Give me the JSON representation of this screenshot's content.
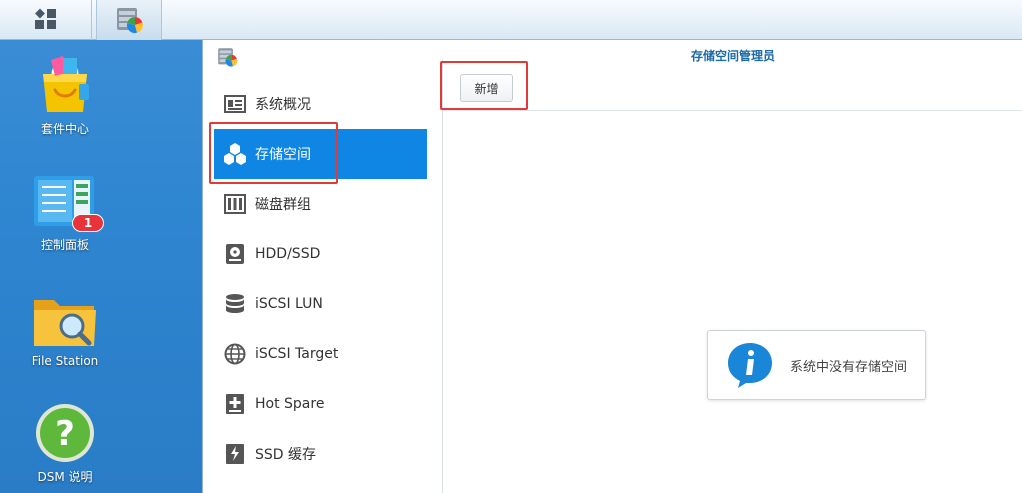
{
  "desktop": {
    "icons": [
      {
        "label": "套件中心"
      },
      {
        "label": "控制面板",
        "badge": "1"
      },
      {
        "label": "File Station"
      },
      {
        "label": "DSM 说明"
      }
    ]
  },
  "window": {
    "title": "存储空间管理员",
    "sidebar": {
      "items": [
        {
          "label": "系统概况",
          "icon": "overview-icon"
        },
        {
          "label": "存储空间",
          "icon": "storage-cubes-icon",
          "active": true
        },
        {
          "label": "磁盘群组",
          "icon": "disk-group-icon"
        },
        {
          "label": "HDD/SSD",
          "icon": "hdd-icon"
        },
        {
          "label": "iSCSI LUN",
          "icon": "database-icon"
        },
        {
          "label": "iSCSI Target",
          "icon": "globe-icon"
        },
        {
          "label": "Hot Spare",
          "icon": "hot-spare-icon"
        },
        {
          "label": "SSD 缓存",
          "icon": "ssd-cache-icon"
        }
      ]
    },
    "toolbar": {
      "add_label": "新增"
    },
    "empty_message": "系统中没有存储空间"
  },
  "colors": {
    "accent": "#0f86e3",
    "title": "#1d6aa8",
    "highlight": "#e03a3a"
  }
}
